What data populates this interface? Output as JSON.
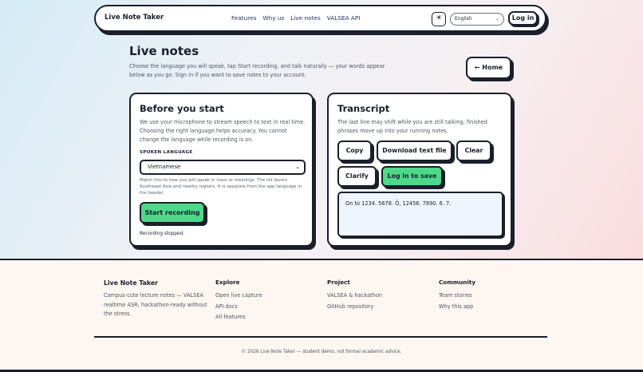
{
  "nav": {
    "brand": "Live Note Taker",
    "links": [
      "Features",
      "Why us",
      "Live notes",
      "VALSEA API"
    ],
    "theme_icon": "sun-icon",
    "language_value": "English",
    "login_label": "Log in"
  },
  "hero": {
    "title": "Live notes",
    "description": "Choose the language you will speak, tap Start recording, and talk naturally — your words appear below as you go. Sign in if you want to save notes to your account.",
    "home_label": "← Home"
  },
  "setup": {
    "title": "Before you start",
    "description": "We use your microphone to stream speech to text in real time. Choosing the right language helps accuracy. You cannot change the language while recording is on.",
    "field_label": "SPOKEN LANGUAGE",
    "language_value": "Vietnamese",
    "hint": "Match this to how you will speak in class or meetings. The list favors Southeast Asia and nearby regions. It is separate from the app language in the header.",
    "start_label": "Start recording",
    "status": "Recording stopped."
  },
  "transcript": {
    "title": "Transcript",
    "description": "The last line may shift while you are still talking; finished phrases move up into your running notes.",
    "buttons": {
      "copy": "Copy",
      "download": "Download text file",
      "clear": "Clear",
      "clarify": "Clarify",
      "save": "Log in to save"
    },
    "text": "On to 1234. 5678. Ō, 12456. 7890. 6. 7."
  },
  "footer": {
    "brand": "Live Note Taker",
    "tagline": "Campus-cute lecture notes — VALSEA realtime ASR, hackathon-ready without the stress.",
    "columns": [
      {
        "heading": "Explore",
        "links": [
          "Open live capture",
          "API docs",
          "All features"
        ]
      },
      {
        "heading": "Project",
        "links": [
          "VALSEA & hackathon",
          "GitHub repository"
        ]
      },
      {
        "heading": "Community",
        "links": [
          "Team stories",
          "Why this app"
        ]
      }
    ],
    "copyright": "© 2026 Live Note Taker — student demo, not formal academic advice."
  },
  "colors": {
    "accent_green": "#4ed98a",
    "ink": "#1a1f2b",
    "transcript_bg": "#eef5fd"
  }
}
